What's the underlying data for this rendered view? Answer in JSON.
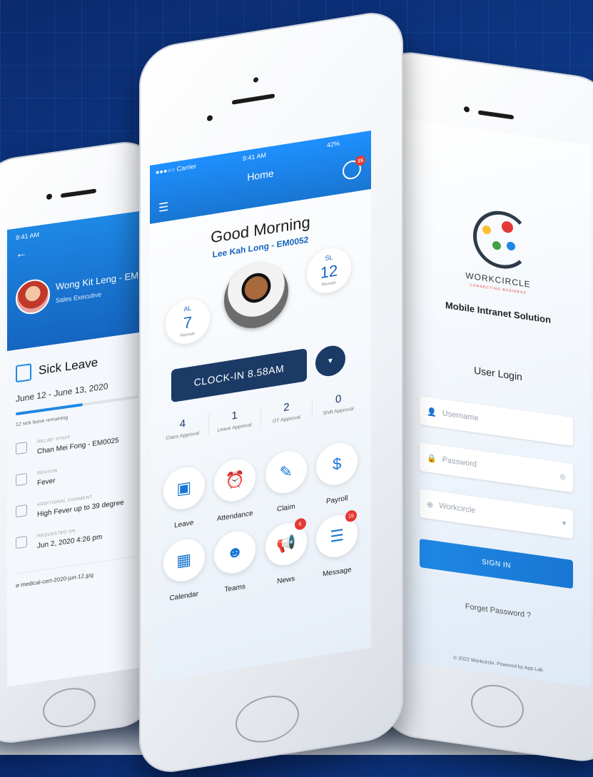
{
  "left_phone": {
    "status_time": "9:41 AM",
    "back_icon": "back-arrow-icon",
    "employee_name": "Wong Kit Leng - EM",
    "employee_title": "Sales Executive",
    "leave_type": "Sick Leave",
    "leave_dates": "June 12 - June 13, 2020",
    "leave_progress": 0.55,
    "leave_remaining": "12 sick leave remaining",
    "details": [
      {
        "icon": "person-icon",
        "label": "RELIEF STAFF",
        "value": "Chan Mei Fong - EM0025"
      },
      {
        "icon": "pencil-icon",
        "label": "REASON",
        "value": "Fever"
      },
      {
        "icon": "comment-icon",
        "label": "ADDITIONAL COMMENT",
        "value": "High Fever up to 39 degree"
      },
      {
        "icon": "calendar-icon",
        "label": "REQUESTED ON",
        "value": "Jun 2, 2020 4:26 pm"
      }
    ],
    "attachment": "medical-cert-2020-jun-12.jpg"
  },
  "center_phone": {
    "carrier": "●●●○○ Carrier",
    "time": "9:41 AM",
    "battery": "42%",
    "message_badge": "15",
    "screen_title": "Home",
    "greeting": "Good Morning",
    "user": "Lee Kah Long - EM0052",
    "al": {
      "label": "AL",
      "value": "7",
      "sub": "Remain"
    },
    "sl": {
      "label": "SL",
      "value": "12",
      "sub": "Remain"
    },
    "clock_in_label": "CLOCK-IN 8.58AM",
    "approvals": [
      {
        "count": "4",
        "label": "Claim Approval"
      },
      {
        "count": "1",
        "label": "Leave Approval"
      },
      {
        "count": "2",
        "label": "OT Approval"
      },
      {
        "count": "0",
        "label": "Shift Approval"
      }
    ],
    "tiles": [
      {
        "label": "Leave",
        "icon": "calendar-check-icon",
        "glyph": "▣",
        "badge": ""
      },
      {
        "label": "Attendance",
        "icon": "alarm-clock-icon",
        "glyph": "⏰",
        "badge": ""
      },
      {
        "label": "Claim",
        "icon": "document-edit-icon",
        "glyph": "✎",
        "badge": ""
      },
      {
        "label": "Payroll",
        "icon": "money-icon",
        "glyph": "$",
        "badge": ""
      },
      {
        "label": "Calendar",
        "icon": "calendar-icon",
        "glyph": "▦",
        "badge": ""
      },
      {
        "label": "Teams",
        "icon": "team-icon",
        "glyph": "☻",
        "badge": ""
      },
      {
        "label": "News",
        "icon": "megaphone-icon",
        "glyph": "📢",
        "badge": "6"
      },
      {
        "label": "Message",
        "icon": "chat-icon",
        "glyph": "☰",
        "badge": "15"
      }
    ]
  },
  "right_phone": {
    "brand": "WORKCIRCLE",
    "tagline": "CONNECTING BUSINESS",
    "subtitle": "Mobile Intranet Solution",
    "login_title": "User Login",
    "username_placeholder": "Username",
    "password_placeholder": "Password",
    "company_placeholder": "Workcircle",
    "signin_label": "SIGN IN",
    "forget_label": "Forget Password ?",
    "copyright": "© 2022 Workcircle. Powered by App Lab"
  },
  "colors": {
    "accent": "#1976d2",
    "dark_navy": "#1b3a66",
    "badge": "#e53935"
  }
}
